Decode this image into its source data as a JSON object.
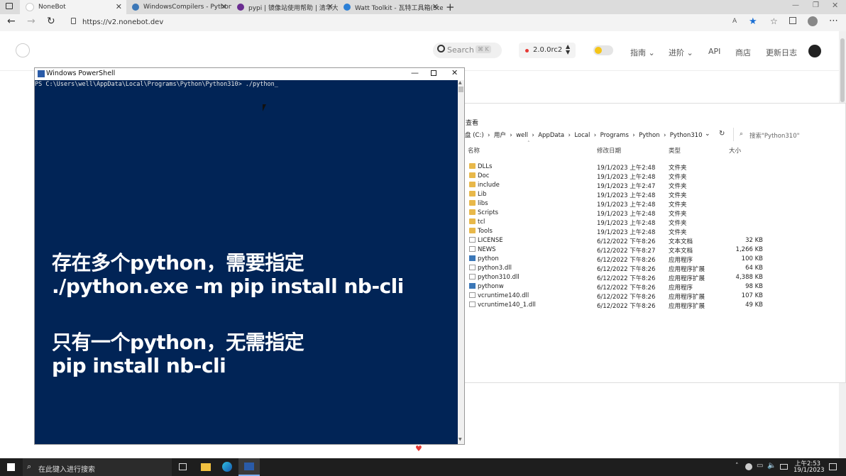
{
  "browser": {
    "tabs": [
      {
        "title": "NoneBot",
        "color": "#ffffff"
      },
      {
        "title": "WindowsCompilers - Python Wi",
        "color": "#3b77b7"
      },
      {
        "title": "pypi | 镜像站使用帮助 | 清华大学",
        "color": "#6a2c91"
      },
      {
        "title": "Watt Toolkit - 瓦特工具箱(Steam",
        "color": "#2b7fd6"
      }
    ],
    "new_tab": "+",
    "url": "https://v2.nonebot.dev"
  },
  "site": {
    "search_placeholder": "Search",
    "search_shortcut": "⌘ K",
    "version": "2.0.0rc2",
    "nav": [
      "指南",
      "进阶",
      "API",
      "商店",
      "更新日志"
    ]
  },
  "explorer": {
    "toolbar_label": "查看",
    "breadcrumb": [
      "盘 (C:)",
      "用户",
      "well",
      "AppData",
      "Local",
      "Programs",
      "Python",
      "Python310"
    ],
    "search_placeholder": "搜索\"Python310\"",
    "columns": [
      "名称",
      "修改日期",
      "类型",
      "大小"
    ],
    "files": [
      {
        "name": "DLLs",
        "date": "19/1/2023 上午2:48",
        "type": "文件夹",
        "size": "",
        "kind": "folder"
      },
      {
        "name": "Doc",
        "date": "19/1/2023 上午2:48",
        "type": "文件夹",
        "size": "",
        "kind": "folder"
      },
      {
        "name": "include",
        "date": "19/1/2023 上午2:47",
        "type": "文件夹",
        "size": "",
        "kind": "folder"
      },
      {
        "name": "Lib",
        "date": "19/1/2023 上午2:48",
        "type": "文件夹",
        "size": "",
        "kind": "folder"
      },
      {
        "name": "libs",
        "date": "19/1/2023 上午2:48",
        "type": "文件夹",
        "size": "",
        "kind": "folder"
      },
      {
        "name": "Scripts",
        "date": "19/1/2023 上午2:48",
        "type": "文件夹",
        "size": "",
        "kind": "folder"
      },
      {
        "name": "tcl",
        "date": "19/1/2023 上午2:48",
        "type": "文件夹",
        "size": "",
        "kind": "folder"
      },
      {
        "name": "Tools",
        "date": "19/1/2023 上午2:48",
        "type": "文件夹",
        "size": "",
        "kind": "folder"
      },
      {
        "name": "LICENSE",
        "date": "6/12/2022 下午8:26",
        "type": "文本文档",
        "size": "32 KB",
        "kind": "file"
      },
      {
        "name": "NEWS",
        "date": "6/12/2022 下午8:27",
        "type": "文本文档",
        "size": "1,266 KB",
        "kind": "file"
      },
      {
        "name": "python",
        "date": "6/12/2022 下午8:26",
        "type": "应用程序",
        "size": "100 KB",
        "kind": "app"
      },
      {
        "name": "python3.dll",
        "date": "6/12/2022 下午8:26",
        "type": "应用程序扩展",
        "size": "64 KB",
        "kind": "file"
      },
      {
        "name": "python310.dll",
        "date": "6/12/2022 下午8:26",
        "type": "应用程序扩展",
        "size": "4,388 KB",
        "kind": "file"
      },
      {
        "name": "pythonw",
        "date": "6/12/2022 下午8:26",
        "type": "应用程序",
        "size": "98 KB",
        "kind": "app"
      },
      {
        "name": "vcruntime140.dll",
        "date": "6/12/2022 下午8:26",
        "type": "应用程序扩展",
        "size": "107 KB",
        "kind": "file"
      },
      {
        "name": "vcruntime140_1.dll",
        "date": "6/12/2022 下午8:26",
        "type": "应用程序扩展",
        "size": "49 KB",
        "kind": "file"
      }
    ]
  },
  "powershell": {
    "title": "Windows PowerShell",
    "prompt": "PS C:\\Users\\well\\AppData\\Local\\Programs\\Python\\Python310> ./python_",
    "overlay": [
      "存在多个python，需要指定",
      "./python.exe -m pip install nb-cli",
      "只有一个python，无需指定",
      "pip install nb-cli"
    ],
    "bg_color": "#012456"
  },
  "taskbar": {
    "search_placeholder": "在此键入进行搜索",
    "time": "上午2:53",
    "date": "19/1/2023"
  }
}
